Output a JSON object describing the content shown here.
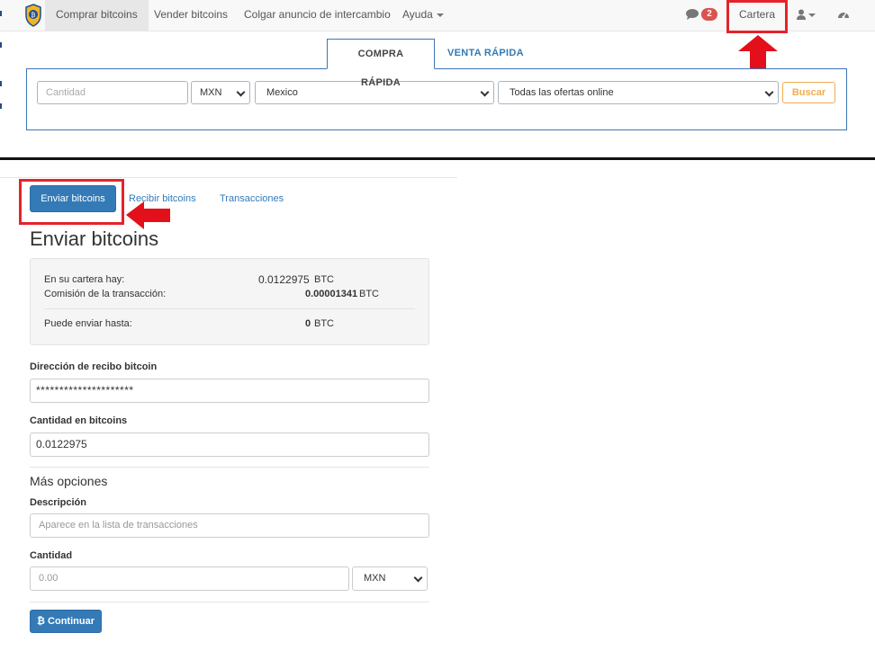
{
  "navbar": {
    "items": [
      "Comprar bitcoins",
      "Vender bitcoins",
      "Colgar anuncio de intercambio",
      "Ayuda"
    ],
    "chat_badge": "2",
    "wallet_label": "Cartera"
  },
  "quick_search": {
    "tabs": [
      "COMPRA RÁPIDA",
      "VENTA RÁPIDA"
    ],
    "amount_placeholder": "Cantidad",
    "currency": "MXN",
    "country": "Mexico",
    "offer_type": "Todas las ofertas online",
    "search_button": "Buscar"
  },
  "wallet": {
    "subnav": [
      "Enviar bitcoins",
      "Recibir bitcoins",
      "Transacciones"
    ],
    "title": "Enviar bitcoins",
    "summary": {
      "balance_label": "En su cartera hay:",
      "balance_value": "0.0122975",
      "balance_unit": "BTC",
      "fee_label": "Comisión de la transacción:",
      "fee_value": "0.00001341",
      "fee_unit": "BTC",
      "max_label": "Puede enviar hasta:",
      "max_value": "0",
      "max_unit": "BTC"
    },
    "address_label": "Dirección de recibo bitcoin",
    "address_value": "*********************",
    "amount_label": "Cantidad en bitcoins",
    "amount_value": "0.0122975",
    "more_options": "Más opciones",
    "description_label": "Descripción",
    "description_placeholder": "Aparece en la lista de transacciones",
    "fiat_amount_label": "Cantidad",
    "fiat_amount_placeholder": "0.00",
    "fiat_currency": "MXN",
    "continue_button": "Continuar"
  },
  "colors": {
    "primary": "#337ab7",
    "highlight": "#e3242b",
    "warning": "#f0ad4e",
    "badge": "#d9534f"
  }
}
